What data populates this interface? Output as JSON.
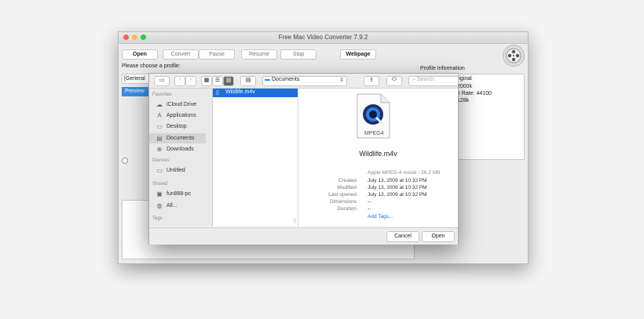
{
  "window": {
    "title": "Free Mac Video Converter 7.9.2"
  },
  "toolbar": {
    "open": "Open",
    "convert": "Convert",
    "pause": "Pause",
    "resume": "Resume",
    "stop": "Stop",
    "webpage": "Webpage"
  },
  "profile": {
    "prompt": "Please choose a profile:",
    "selected": "[General",
    "info_title": "Profile Information",
    "info_lines": [
      "riginal",
      "2000k",
      "e Rate: 44100",
      "128k"
    ],
    "preview_tab": "Preview"
  },
  "dialog": {
    "location": "Documents",
    "search_placeholder": "Search",
    "sidebar": {
      "favorites_header": "Favorites",
      "favorites": [
        "iCloud Drive",
        "Applications",
        "Desktop",
        "Documents",
        "Downloads"
      ],
      "devices_header": "Devices",
      "devices": [
        "Untitled"
      ],
      "shared_header": "Shared",
      "shared": [
        "fun888-pc",
        "All..."
      ],
      "tags_header": "Tags"
    },
    "file": "Wildlife.m4v",
    "preview": {
      "icon_label": "MPEG4",
      "name": "Wildlife.m4v",
      "kind": "Apple MPEG-4 movie - 26.2 MB",
      "created_k": "Created",
      "created_v": "July 13, 2009 at 10:32 PM",
      "modified_k": "Modified",
      "modified_v": "July 13, 2009 at 10:32 PM",
      "opened_k": "Last opened",
      "opened_v": "July 13, 2009 at 10:32 PM",
      "dims_k": "Dimensions",
      "dims_v": "--",
      "dur_k": "Duration",
      "dur_v": "--",
      "tags": "Add Tags..."
    },
    "cancel": "Cancel",
    "open": "Open"
  },
  "colors": {
    "accent": "#1f6fd6",
    "close": "#fc605c",
    "min": "#fdbc40",
    "max": "#34c84a"
  }
}
